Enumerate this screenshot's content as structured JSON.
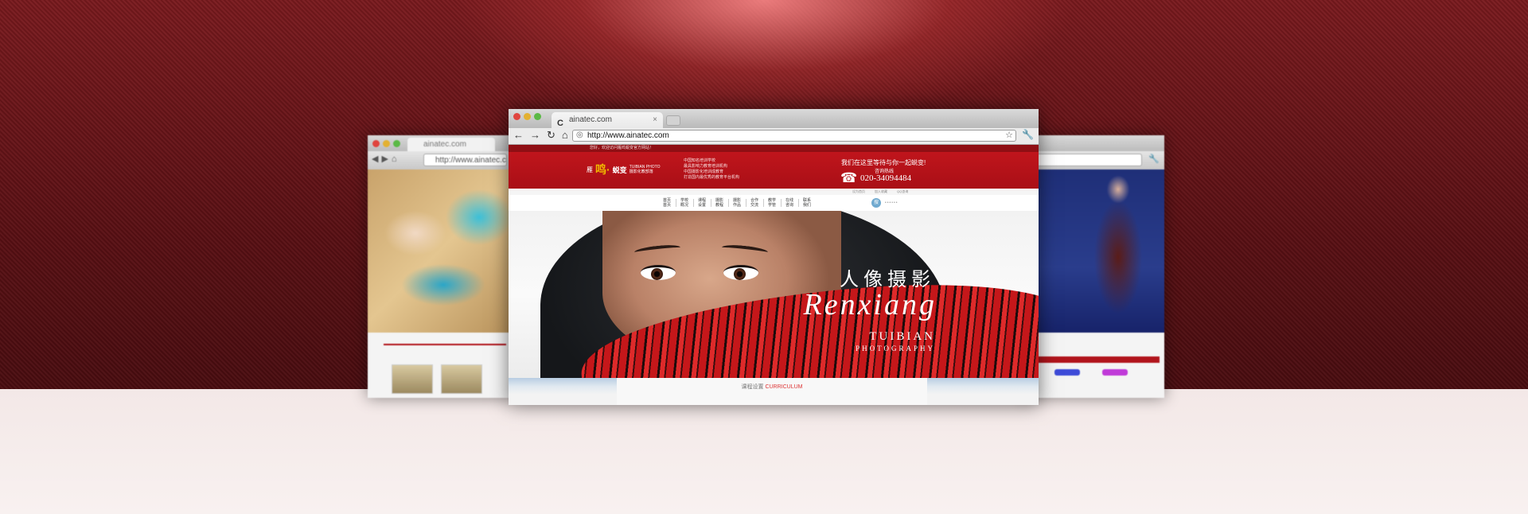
{
  "side_left": {
    "tab_title": "ainatec.com",
    "url": "http://www.ainatec.c"
  },
  "main_browser": {
    "tab_title": "ainatec.com",
    "favicon": "C",
    "url": "http://www.ainatec.com",
    "nav_icons": [
      "back-icon",
      "forward-icon",
      "reload-icon",
      "home-icon"
    ]
  },
  "site": {
    "top_greeting": "您好，欢迎访问雁鸣蜕变官方网站！",
    "logo": {
      "mark": "雁",
      "brand": "鸣·",
      "name": "蜕变",
      "sub": "TUIBIAN PHOTO 摄影化教部落"
    },
    "slogans": [
      "中国知名培训学校",
      "最具影响力教育培训机构",
      "中国摄影化培训成教育",
      "打造国内最优秀的教育平台机构"
    ],
    "hotline_title": "我们在这里等待与你一起蜕变!",
    "hotline_label": "咨询热线",
    "hotline_number": "020-34094484",
    "top_links": [
      "设为首页",
      "加入收藏",
      "QQ咨询"
    ],
    "menu": [
      "首页首页",
      "学校概况",
      "课程设置",
      "摄影教程",
      "摄影作品",
      "合作交流",
      "教学学管",
      "在线咨询",
      "联系我们"
    ],
    "search_label": "搜"
  },
  "hero": {
    "title_cn": "人像摄影",
    "title_en": "Renxiang",
    "sub1": "TUIBIAN",
    "sub2": "PHOTOGRAPHY"
  },
  "curriculum": {
    "label_cn": "课程设置",
    "label_en": "CURRICULUM"
  },
  "colors": {
    "brand_red": "#b1141b",
    "hotline_gold": "#f0b800",
    "bg_dark_red": "#5a1014"
  }
}
